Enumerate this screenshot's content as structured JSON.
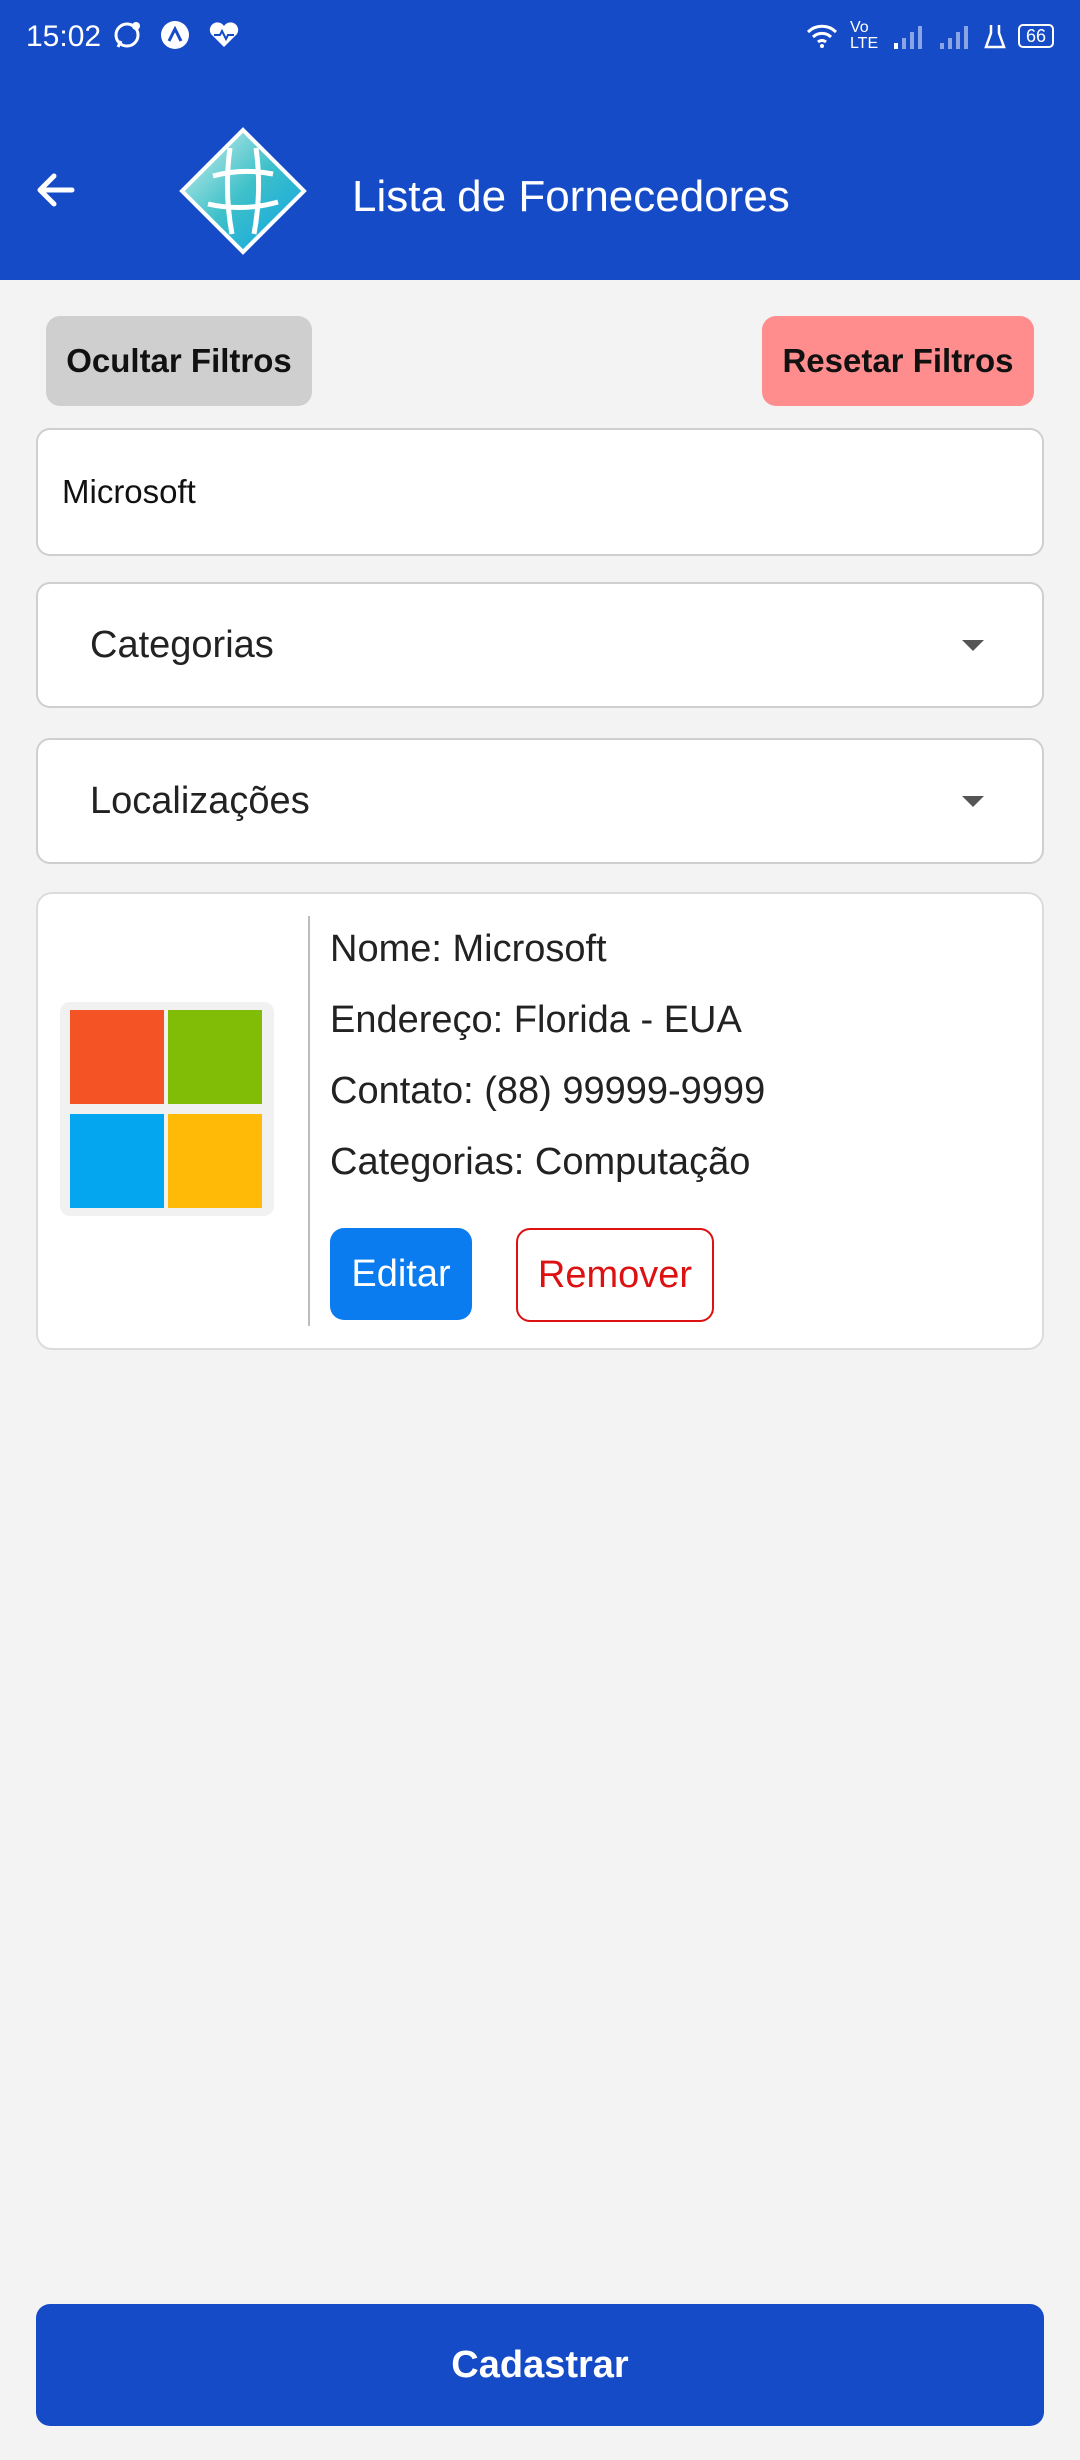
{
  "status_bar": {
    "time": "15:02",
    "left_icons": [
      "whatsapp-icon",
      "app-icon",
      "heart-icon"
    ],
    "right_icons": [
      "wifi-icon",
      "volte-icon",
      "signal-icon",
      "signal-icon",
      "flask-icon"
    ],
    "volte": "Vo LTE",
    "battery": "66"
  },
  "app_bar": {
    "back_icon": "arrow-left-icon",
    "logo_icon": "app-logo",
    "title": "Lista de Fornecedores"
  },
  "filters": {
    "hide_label": "Ocultar Filtros",
    "reset_label": "Resetar Filtros",
    "search_value": "Microsoft",
    "categories_label": "Categorias",
    "locations_label": "Localizações"
  },
  "suppliers": [
    {
      "logo": "microsoft-logo",
      "name": "Nome: Microsoft",
      "address": "Endereço: Florida - EUA",
      "contact": "Contato: (88) 99999-9999",
      "categories": "Categorias: Computação",
      "edit_label": "Editar",
      "remove_label": "Remover"
    }
  ],
  "register_label": "Cadastrar",
  "colors": {
    "primary": "#164bc8",
    "edit": "#0a7cf0",
    "remove": "#dd1111",
    "reset": "#ff8d8d",
    "hide": "#cfcfcf"
  }
}
